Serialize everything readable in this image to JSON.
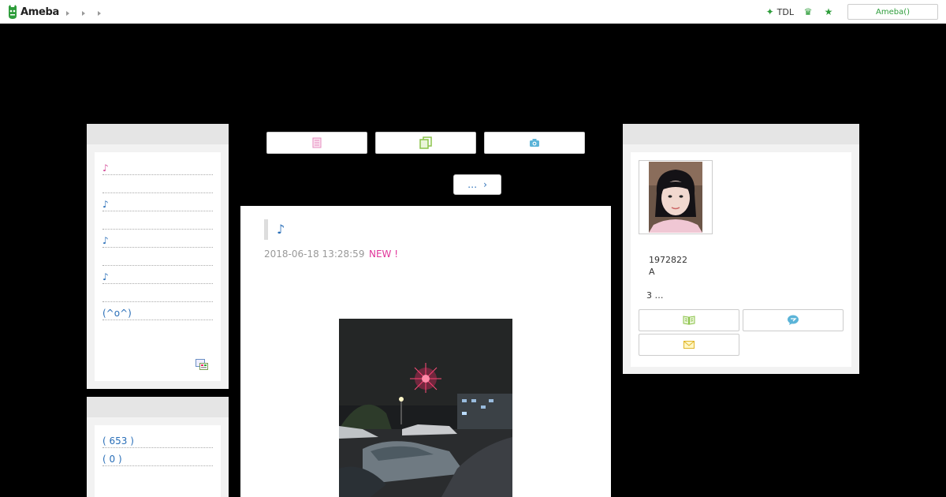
{
  "topbar": {
    "logo_text": "Ameba",
    "tdl_label": "TDL",
    "ameba_button": "Ameba()"
  },
  "left": {
    "theme_items": [
      {
        "label": "♪",
        "color": "#d44d9a"
      },
      {
        "label": ""
      },
      {
        "label": " ♪"
      },
      {
        "label": ""
      },
      {
        "label": "♪"
      },
      {
        "label": ""
      },
      {
        "label": "♪"
      },
      {
        "label": ""
      },
      {
        "label": " (^o^)"
      }
    ],
    "counts": [
      {
        "label": " ( 653 )"
      },
      {
        "label": " ( 0 )"
      }
    ]
  },
  "center": {
    "more_label": "…",
    "entry": {
      "title": "♪",
      "date": "2018-06-18 13:28:59",
      "new_badge": "NEW !"
    }
  },
  "right": {
    "profile": {
      "line1": "1972822",
      "line2": "A",
      "line3": "3 …"
    }
  },
  "colors": {
    "accent_green": "#2e9d3b",
    "link_blue": "#2a6fb8",
    "new_pink": "#e0359a"
  }
}
